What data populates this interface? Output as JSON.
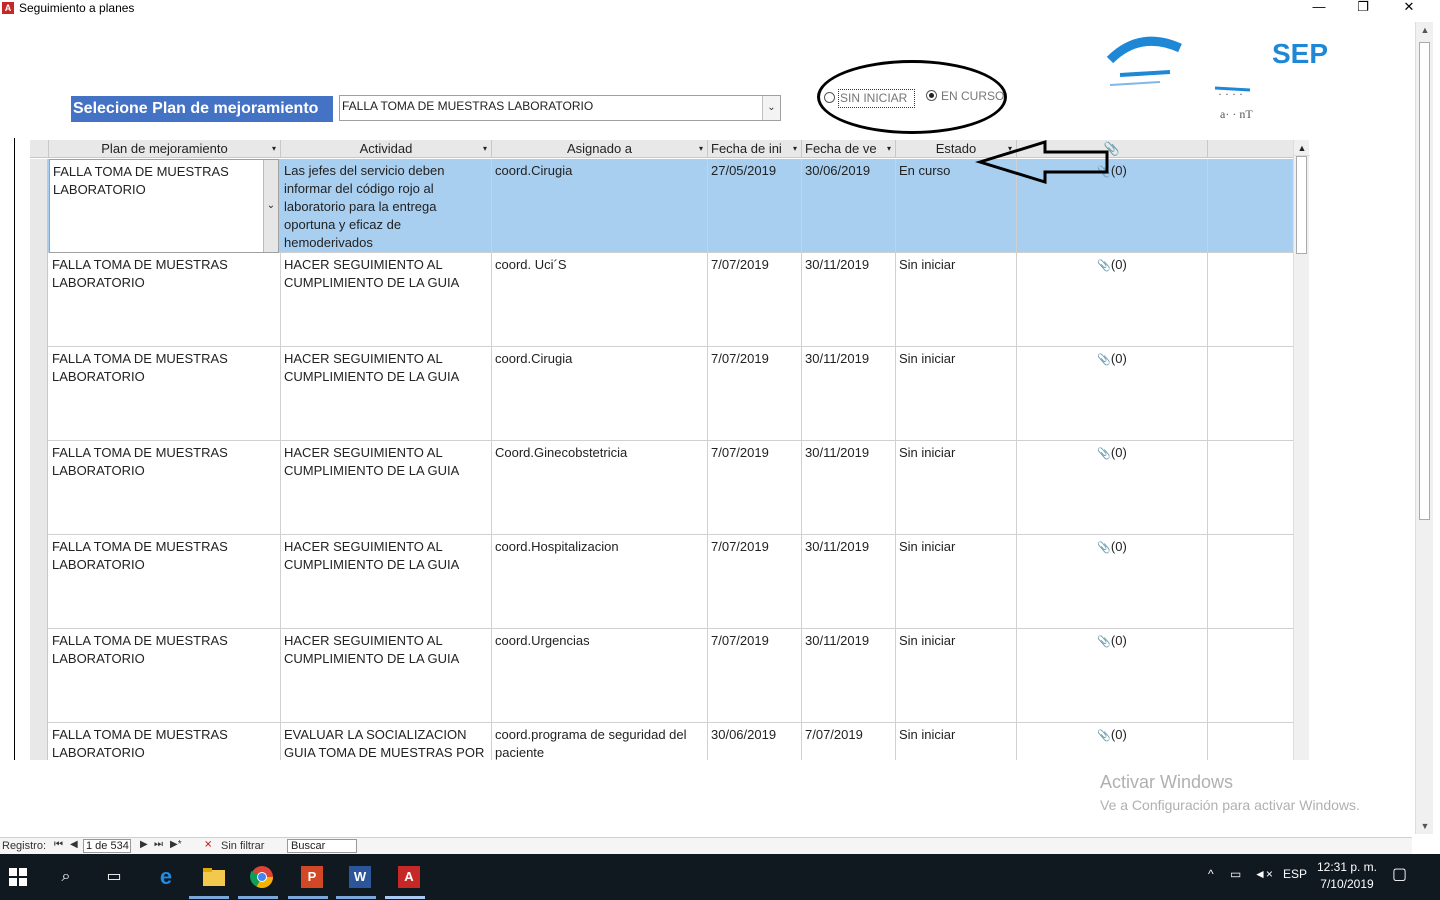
{
  "window": {
    "title": "Seguimiento a planes",
    "app_icon": "A",
    "minimize": "—",
    "restore": "❐",
    "close": "✕"
  },
  "form": {
    "plan_label": "Selecione Plan de mejoramiento",
    "plan_value": "FALLA TOMA DE MUESTRAS LABORATORIO",
    "status_options": [
      {
        "label": "SIN INICIAR",
        "selected": false
      },
      {
        "label": "EN CURSO",
        "selected": true
      }
    ]
  },
  "grid": {
    "columns": [
      "Plan de mejoramiento",
      "Actividad",
      "Asignado a",
      "Fecha de ini",
      "Fecha de ve",
      "Estado",
      "📎"
    ],
    "rows": [
      {
        "plan": "FALLA TOMA DE MUESTRAS LABORATORIO",
        "actividad": "Las jefes del servicio deben informar del código rojo al laboratorio para la entrega oportuna y eficaz de hemoderivados",
        "asignado": "coord.Cirugia",
        "fecha_ini": "27/05/2019",
        "fecha_ve": "30/06/2019",
        "estado": "En curso",
        "adjuntos": "(0)"
      },
      {
        "plan": "FALLA TOMA DE MUESTRAS LABORATORIO",
        "actividad": "HACER SEGUIMIENTO AL CUMPLIMIENTO DE LA GUIA",
        "asignado": "coord. Uci´S",
        "fecha_ini": "7/07/2019",
        "fecha_ve": "30/11/2019",
        "estado": "Sin iniciar",
        "adjuntos": "(0)"
      },
      {
        "plan": "FALLA TOMA DE MUESTRAS LABORATORIO",
        "actividad": "HACER SEGUIMIENTO AL CUMPLIMIENTO DE LA GUIA",
        "asignado": "coord.Cirugia",
        "fecha_ini": "7/07/2019",
        "fecha_ve": "30/11/2019",
        "estado": "Sin iniciar",
        "adjuntos": "(0)"
      },
      {
        "plan": "FALLA TOMA DE MUESTRAS LABORATORIO",
        "actividad": "HACER SEGUIMIENTO AL CUMPLIMIENTO DE LA GUIA",
        "asignado": "Coord.Ginecobstetricia",
        "fecha_ini": "7/07/2019",
        "fecha_ve": "30/11/2019",
        "estado": "Sin iniciar",
        "adjuntos": "(0)"
      },
      {
        "plan": "FALLA TOMA DE MUESTRAS LABORATORIO",
        "actividad": "HACER SEGUIMIENTO AL CUMPLIMIENTO DE LA GUIA",
        "asignado": "coord.Hospitalizacion",
        "fecha_ini": "7/07/2019",
        "fecha_ve": "30/11/2019",
        "estado": "Sin iniciar",
        "adjuntos": "(0)"
      },
      {
        "plan": "FALLA TOMA DE MUESTRAS LABORATORIO",
        "actividad": "HACER SEGUIMIENTO AL CUMPLIMIENTO DE LA GUIA",
        "asignado": "coord.Urgencias",
        "fecha_ini": "7/07/2019",
        "fecha_ve": "30/11/2019",
        "estado": "Sin iniciar",
        "adjuntos": "(0)"
      },
      {
        "plan": "FALLA TOMA DE MUESTRAS LABORATORIO",
        "actividad": "EVALUAR LA SOCIALIZACION GUIA TOMA DE MUESTRAS POR",
        "asignado": "coord.programa de seguridad del paciente",
        "fecha_ini": "30/06/2019",
        "fecha_ve": "7/07/2019",
        "estado": "Sin iniciar",
        "adjuntos": "(0)"
      }
    ]
  },
  "watermark": {
    "line1": "Activar Windows",
    "line2": "Ve a Configuración para activar Windows."
  },
  "navigation": {
    "label": "Registro:",
    "first": "⏮",
    "prev": "◀",
    "record": "1 de 534",
    "next": "▶",
    "last": "⏭",
    "new": "▶*",
    "filter": "Sin filtrar",
    "search": "Buscar"
  },
  "taskbar": {
    "time": "12:31 p. m.",
    "date": "7/10/2019",
    "language": "ESP"
  },
  "colors": {
    "label_bg": "#4472c4",
    "selected_row": "#a8cef0",
    "taskbar": "#101820"
  }
}
